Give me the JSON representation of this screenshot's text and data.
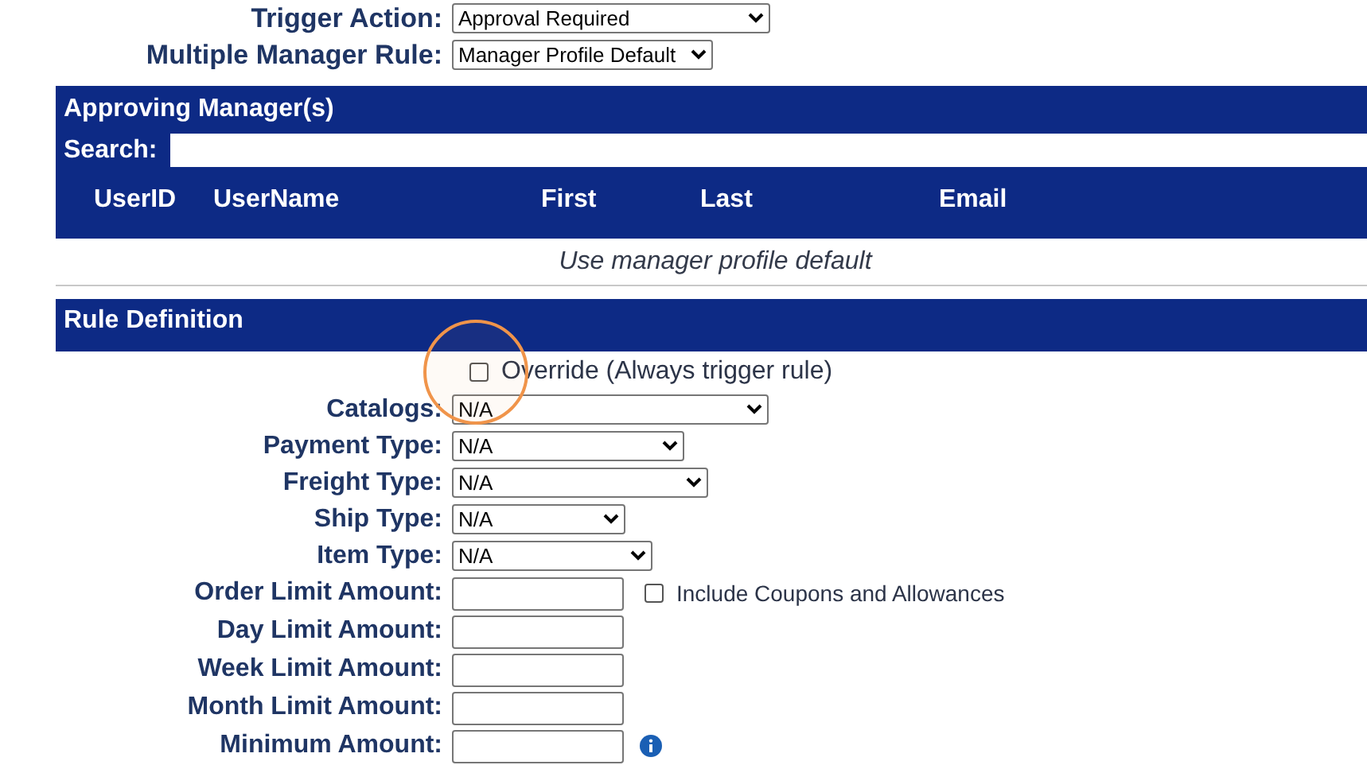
{
  "settings": [
    {
      "label": "Trigger Action:",
      "kind": "select",
      "value": "Approval Required"
    },
    {
      "label": "Multiple Manager Rule:",
      "kind": "select",
      "value": "Manager Profile Default"
    }
  ],
  "approving_managers": {
    "title": "Approving Manager(s)",
    "search_label": "Search:",
    "columns": [
      "UserID",
      "UserName",
      "First",
      "Last",
      "Email"
    ],
    "empty_message": "Use manager profile default"
  },
  "rule_definition": {
    "title": "Rule Definition",
    "override": {
      "label": "Override (Always trigger rule)",
      "checked": false,
      "highlighted": true
    },
    "fields": [
      {
        "label": "Catalogs:",
        "kind": "select",
        "value": "N/A"
      },
      {
        "label": "Payment Type:",
        "kind": "select",
        "value": "N/A"
      },
      {
        "label": "Freight Type:",
        "kind": "select",
        "value": "N/A"
      },
      {
        "label": "Ship Type:",
        "kind": "select",
        "value": "N/A"
      },
      {
        "label": "Item Type:",
        "kind": "select",
        "value": "N/A"
      },
      {
        "label": "Order Limit Amount:",
        "kind": "input",
        "option": {
          "label": "Include Coupons and Allowances",
          "checked": false
        }
      },
      {
        "label": "Day Limit Amount:",
        "kind": "input"
      },
      {
        "label": "Week Limit Amount:",
        "kind": "input"
      },
      {
        "label": "Month Limit Amount:",
        "kind": "input"
      },
      {
        "label": "Minimum Amount:",
        "kind": "input",
        "info": true
      }
    ]
  }
}
